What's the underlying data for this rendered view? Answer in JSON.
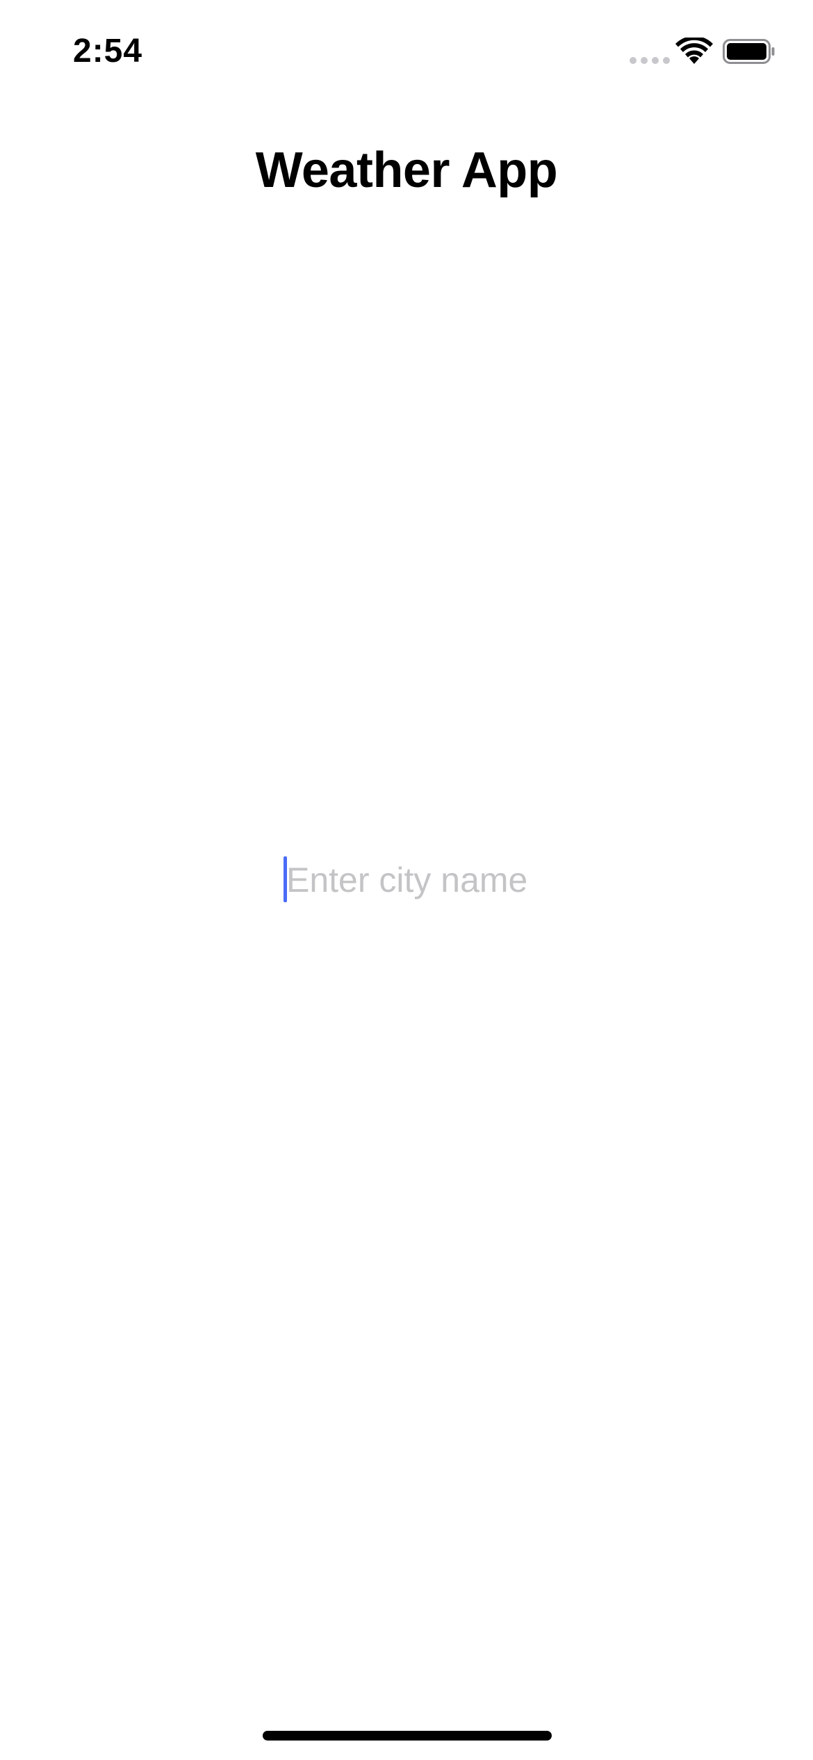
{
  "status_bar": {
    "time": "2:54",
    "icons": [
      "cellular-signal-icon",
      "wifi-icon",
      "battery-icon"
    ]
  },
  "header": {
    "title": "Weather App"
  },
  "search": {
    "value": "",
    "placeholder": "Enter city name"
  },
  "colors": {
    "caret": "#4a6cf7",
    "placeholder": "#c4c4c6",
    "background": "#ffffff",
    "text": "#000000"
  }
}
